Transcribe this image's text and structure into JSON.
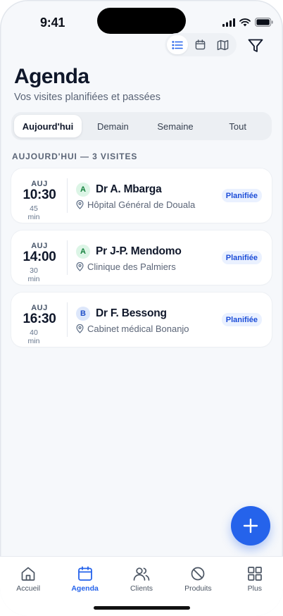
{
  "status_bar": {
    "time": "9:41"
  },
  "toolbar": {
    "views": [
      {
        "name": "list",
        "icon": "list-icon",
        "active": true
      },
      {
        "name": "calendar",
        "icon": "calendar-icon",
        "active": false
      },
      {
        "name": "map",
        "icon": "map-icon",
        "active": false
      }
    ],
    "filter_icon": "filter-icon"
  },
  "header": {
    "title": "Agenda",
    "subtitle": "Vos visites planifiées et passées"
  },
  "tabs": [
    {
      "label": "Aujourd'hui",
      "active": true
    },
    {
      "label": "Demain",
      "active": false
    },
    {
      "label": "Semaine",
      "active": false
    },
    {
      "label": "Tout",
      "active": false
    }
  ],
  "section": {
    "label": "AUJOURD'HUI — 3 VISITES"
  },
  "visits": [
    {
      "day": "AUJ",
      "time": "10:30",
      "duration": "45 min",
      "category": "A",
      "name": "Dr A. Mbarga",
      "place": "Hôpital Général de Douala",
      "status": "Planifiée"
    },
    {
      "day": "AUJ",
      "time": "14:00",
      "duration": "30 min",
      "category": "A",
      "name": "Pr J-P. Mendomo",
      "place": "Clinique des Palmiers",
      "status": "Planifiée"
    },
    {
      "day": "AUJ",
      "time": "16:30",
      "duration": "40 min",
      "category": "B",
      "name": "Dr F. Bessong",
      "place": "Cabinet médical Bonanjo",
      "status": "Planifiée"
    }
  ],
  "bottom_nav": [
    {
      "label": "Accueil",
      "icon": "home-icon",
      "active": false
    },
    {
      "label": "Agenda",
      "icon": "calendar-icon",
      "active": true
    },
    {
      "label": "Clients",
      "icon": "users-icon",
      "active": false
    },
    {
      "label": "Produits",
      "icon": "pill-icon",
      "active": false
    },
    {
      "label": "Plus",
      "icon": "grid-icon",
      "active": false
    }
  ],
  "colors": {
    "accent": "#2563eb",
    "category_a_bg": "#dcf5e6",
    "category_a_fg": "#14803d",
    "category_b_bg": "#dde7fb",
    "category_b_fg": "#2150c8",
    "status_bg": "#eaf1ff",
    "status_fg": "#1d4ed8"
  }
}
